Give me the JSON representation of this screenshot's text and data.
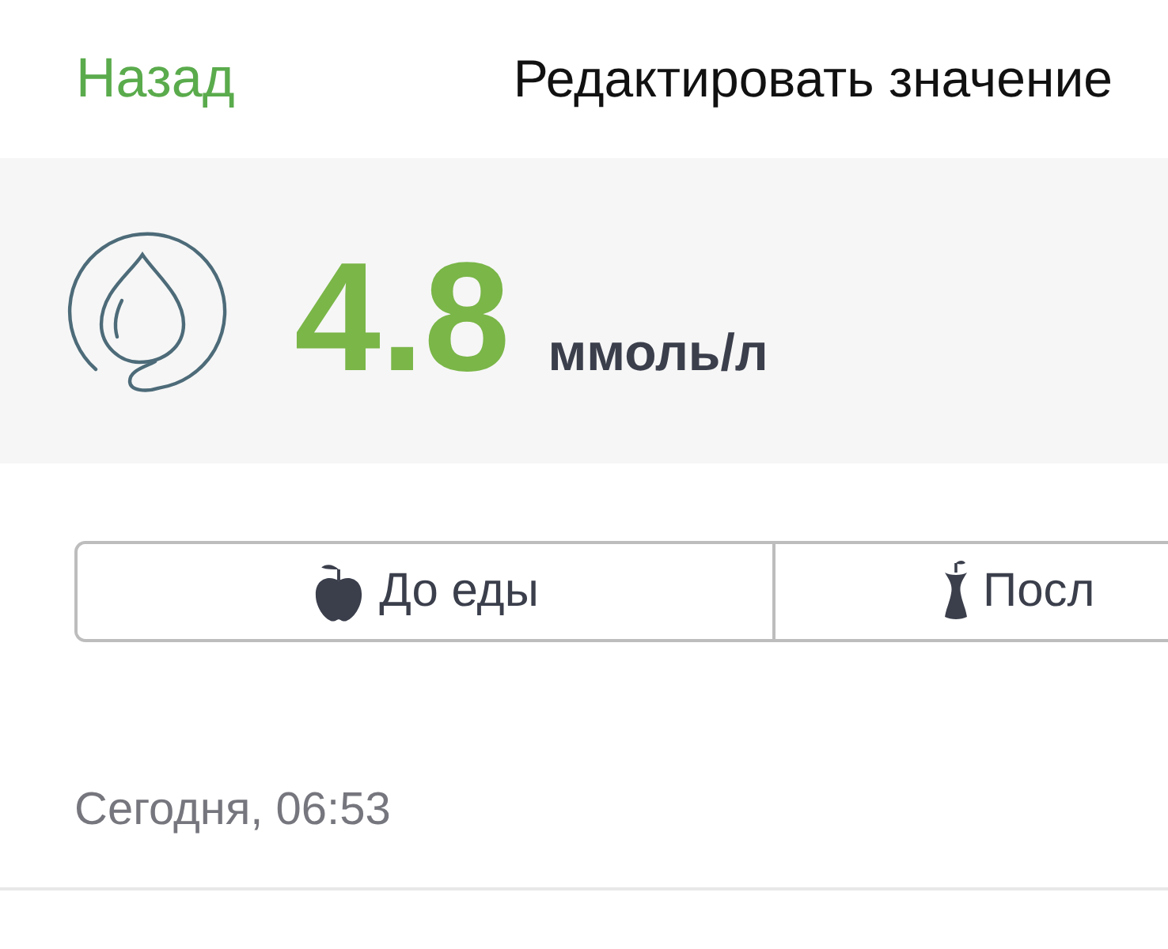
{
  "nav": {
    "back": "Назад",
    "title": "Редактировать значение"
  },
  "reading": {
    "value": "4.8",
    "unit": "ммоль/л"
  },
  "meal_segments": [
    {
      "label": "До еды",
      "selected": false
    },
    {
      "label": "Посл",
      "selected": false
    }
  ],
  "timestamp": "Сегодня, 06:53"
}
